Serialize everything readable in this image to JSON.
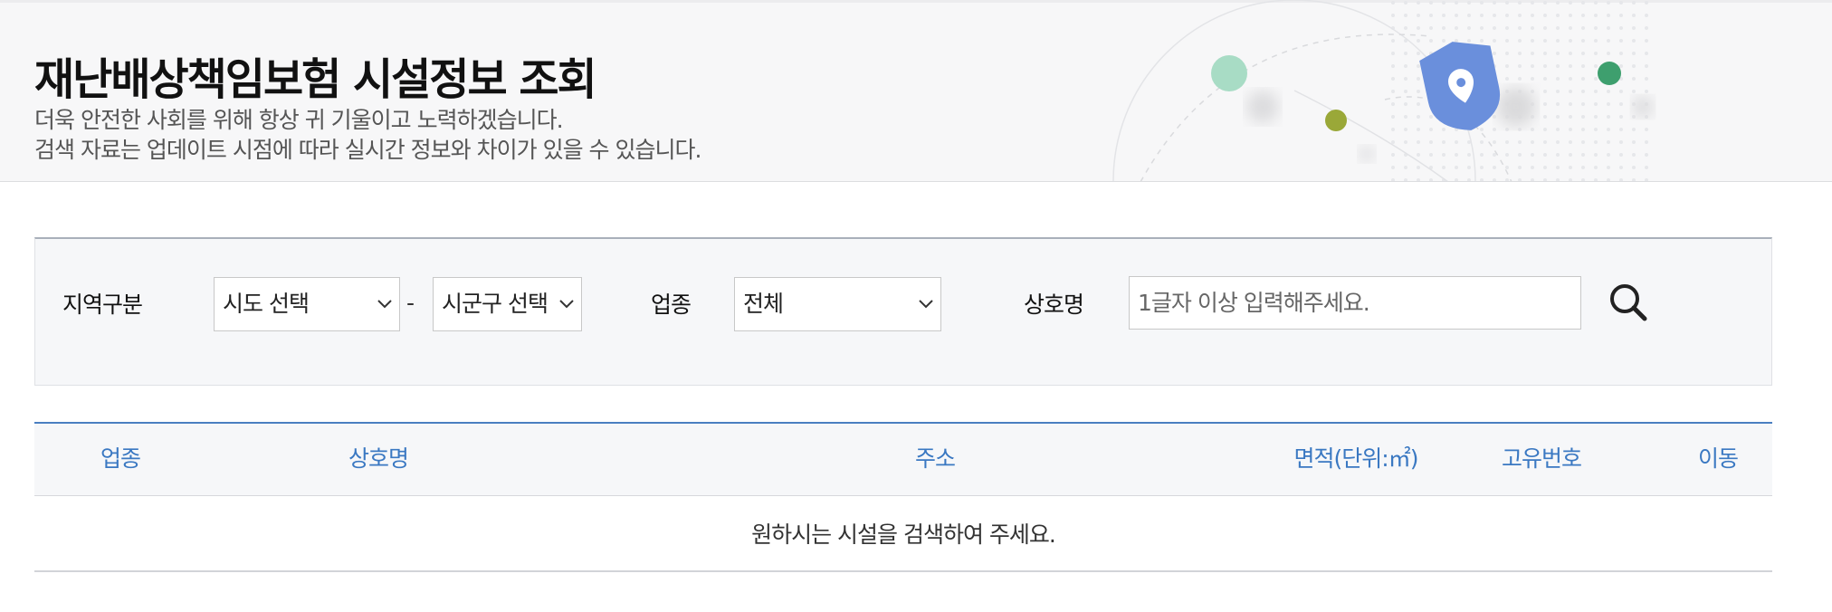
{
  "header": {
    "title": "재난배상책임보험 시설정보 조회",
    "subtitle_line1": "더욱 안전한 사회를 위해 항상 귀 기울이고 노력하겠습니다.",
    "subtitle_line2": "검색 자료는 업데이트 시점에 따라 실시간 정보와 차이가 있을 수 있습니다."
  },
  "search": {
    "region_label": "지역구분",
    "sido_select": "시도 선택",
    "separator": "-",
    "sigungu_select": "시군구 선택",
    "industry_label": "업종",
    "industry_select": "전체",
    "name_label": "상호명",
    "name_placeholder": "1글자 이상 입력해주세요."
  },
  "table": {
    "columns": [
      "업종",
      "상호명",
      "주소",
      "면적(단위:㎡)",
      "고유번호",
      "이동"
    ],
    "empty_message": "원하시는 시설을 검색하여 주세요."
  },
  "icons": {
    "search": "search-icon",
    "dropdown": "chevron-down-icon",
    "shield": "shield-location-icon"
  },
  "colors": {
    "accent": "#3a78c2",
    "table_border": "#4a7fc1",
    "header_bg": "#f7f7f8",
    "panel_bg": "#f6f7f9",
    "shield": "#6a8fdc",
    "dot_mint": "#a8dcc5",
    "dot_olive": "#9aa838",
    "dot_green": "#3e9f6e"
  }
}
